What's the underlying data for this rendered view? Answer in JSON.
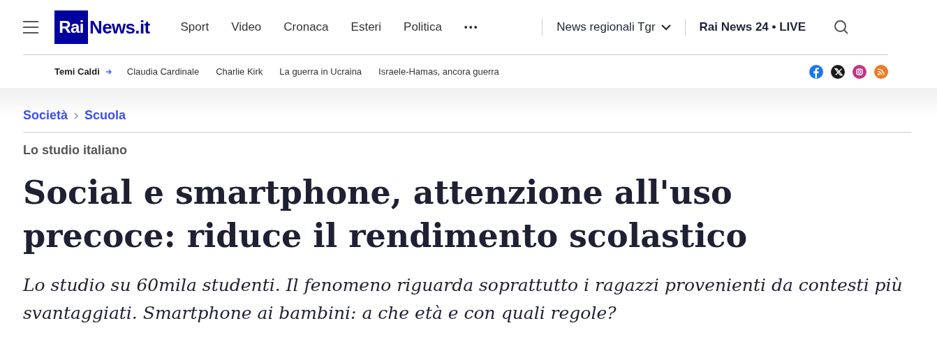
{
  "header": {
    "logo": {
      "box_text": "Rai",
      "text": "News.it"
    },
    "nav": [
      "Sport",
      "Video",
      "Cronaca",
      "Esteri",
      "Politica"
    ],
    "more": "•••",
    "regional": "News regionali Tgr",
    "live": "Rai News 24 • LIVE"
  },
  "hot_topics": {
    "label": "Temi Caldi",
    "items": [
      "Claudia Cardinale",
      "Charlie Kirk",
      "La guerra in Ucraina",
      "Israele-Hamas, ancora guerra"
    ],
    "social": [
      {
        "kind": "facebook",
        "color": "#1877f2"
      },
      {
        "kind": "x",
        "color": "#1a1a1a"
      },
      {
        "kind": "instagram",
        "color": "#c13584"
      },
      {
        "kind": "rss",
        "color": "#f07a24"
      }
    ]
  },
  "breadcrumb": [
    "Società",
    "Scuola"
  ],
  "article": {
    "kicker": "Lo studio italiano",
    "title": "Social e smartphone, attenzione all'uso precoce: riduce il rendimento scolastico",
    "subtitle": "Lo studio su 60mila studenti. Il fenomeno riguarda soprattutto i ragazzi provenienti da contesti più svantaggiati. Smartphone ai bambini: a che età e con quali regole?"
  }
}
